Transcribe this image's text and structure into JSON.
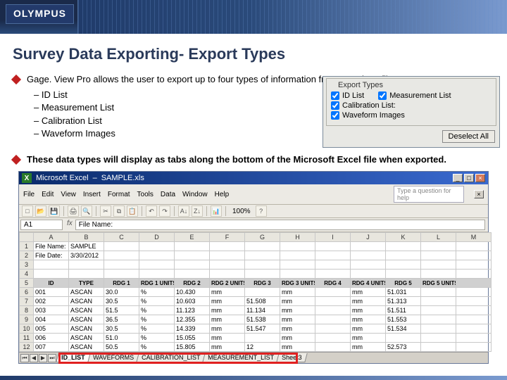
{
  "brand": "OLYMPUS",
  "title": "Survey Data Exporting- Export Types",
  "intro": "Gage. View Pro allows the user to export up to four types of information from any given file:",
  "sublist": [
    "ID List",
    "Measurement List",
    "Calibration List",
    "Waveform Images"
  ],
  "note": "These data types will display as tabs along the bottom of the Microsoft Excel file when exported.",
  "export_panel": {
    "title": "Export Types",
    "cb": {
      "id_list": "ID List",
      "meas_list": "Measurement List",
      "cal_list": "Calibration List:",
      "wave": "Waveform Images"
    },
    "deselect": "Deselect All"
  },
  "excel": {
    "app": "Microsoft Excel",
    "file": "SAMPLE.xls",
    "menus": [
      "File",
      "Edit",
      "View",
      "Insert",
      "Format",
      "Tools",
      "Data",
      "Window",
      "Help"
    ],
    "help_placeholder": "Type a question for help",
    "name_box": "A1",
    "formula": "File Name:",
    "col_letters": [
      "A",
      "B",
      "C",
      "D",
      "E",
      "F",
      "G",
      "H",
      "I",
      "J",
      "K",
      "L",
      "M"
    ],
    "meta_rows": [
      {
        "n": "1",
        "a": "File Name:",
        "b": "SAMPLE"
      },
      {
        "n": "2",
        "a": "File Date:",
        "b": "3/30/2012"
      },
      {
        "n": "3",
        "a": ""
      },
      {
        "n": "4",
        "a": ""
      }
    ],
    "header_row_n": "5",
    "headers": [
      "ID",
      "TYPE",
      "RDG 1",
      "RDG 1 UNITS",
      "RDG 2",
      "RDG 2 UNITS",
      "RDG 3",
      "RDG 3 UNITS",
      "RDG 4",
      "RDG 4 UNITS",
      "RDG 5",
      "RDG 5 UNITS"
    ],
    "rows": [
      {
        "n": "6",
        "id": "001",
        "type": "ASCAN",
        "r1": "30.0",
        "u1": "%",
        "r2": "10.430",
        "u2": "mm",
        "r3": "",
        "u3": "mm",
        "r4": "",
        "u4": "mm",
        "r5": "51.031",
        "u5": ""
      },
      {
        "n": "7",
        "id": "002",
        "type": "ASCAN",
        "r1": "30.5",
        "u1": "%",
        "r2": "10.603",
        "u2": "mm",
        "r3": "51.508",
        "u3": "mm",
        "r4": "",
        "u4": "mm",
        "r5": "51.313",
        "u5": ""
      },
      {
        "n": "8",
        "id": "003",
        "type": "ASCAN",
        "r1": "51.5",
        "u1": "%",
        "r2": "11.123",
        "u2": "mm",
        "r3": "11.134",
        "u3": "mm",
        "r4": "",
        "u4": "mm",
        "r5": "51.511",
        "u5": ""
      },
      {
        "n": "9",
        "id": "004",
        "type": "ASCAN",
        "r1": "36.5",
        "u1": "%",
        "r2": "12.355",
        "u2": "mm",
        "r3": "51.538",
        "u3": "mm",
        "r4": "",
        "u4": "mm",
        "r5": "51.553",
        "u5": ""
      },
      {
        "n": "10",
        "id": "005",
        "type": "ASCAN",
        "r1": "30.5",
        "u1": "%",
        "r2": "14.339",
        "u2": "mm",
        "r3": "51.547",
        "u3": "mm",
        "r4": "",
        "u4": "mm",
        "r5": "51.534",
        "u5": ""
      },
      {
        "n": "11",
        "id": "006",
        "type": "ASCAN",
        "r1": "51.0",
        "u1": "%",
        "r2": "15.055",
        "u2": "mm",
        "r3": "",
        "u3": "mm",
        "r4": "",
        "u4": "mm",
        "r5": "",
        "u5": ""
      },
      {
        "n": "12",
        "id": "007",
        "type": "ASCAN",
        "r1": "50.5",
        "u1": "%",
        "r2": "15.805",
        "u2": "mm",
        "r3": "12",
        "u3": "mm",
        "r4": "",
        "u4": "mm",
        "r5": "52.573",
        "u5": ""
      }
    ],
    "tabs": [
      "ID_LIST",
      "WAVEFORMS",
      "CALIBRATION_LIST",
      "MEASUREMENT_LIST",
      "Sheet3"
    ]
  }
}
